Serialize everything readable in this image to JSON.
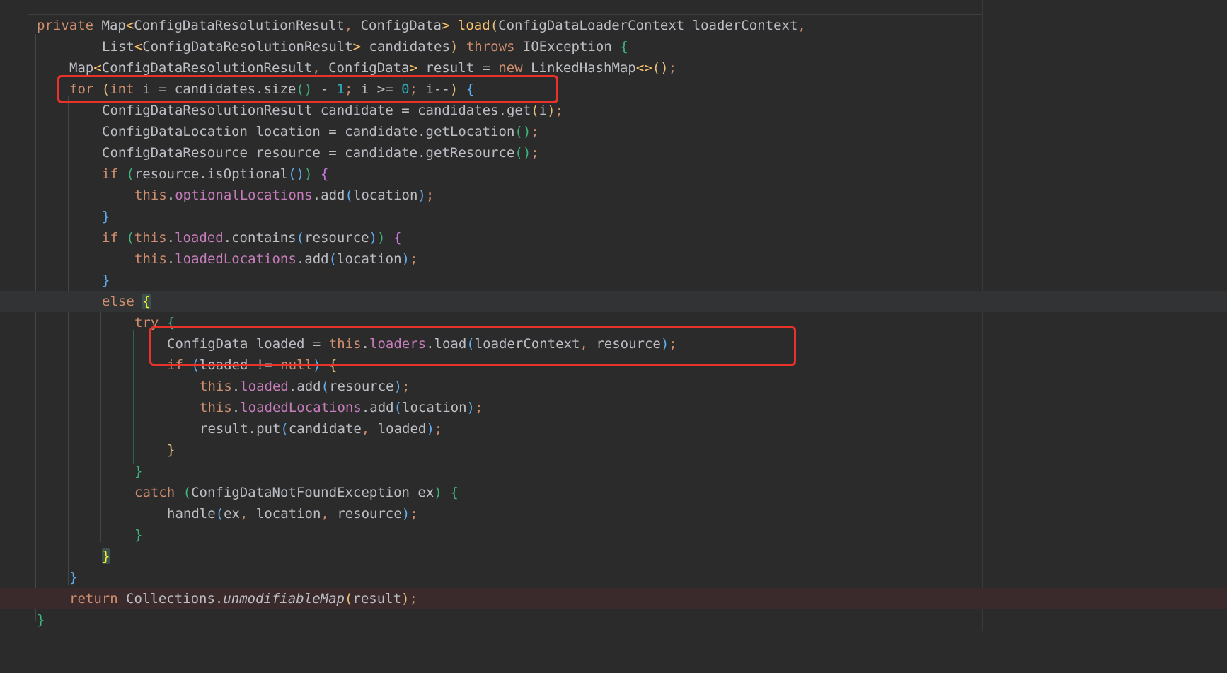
{
  "editor": {
    "language": "Java",
    "theme": "dark",
    "colors": {
      "background": "#2b2b2c",
      "keyword": "#cf8e6d",
      "text": "#bcbec4",
      "field": "#c77dbb",
      "number": "#2aacb8",
      "highlight_box": "#e8322a",
      "error_line": "#3a2a2c"
    },
    "lines": [
      "private Map<ConfigDataResolutionResult, ConfigData> load(ConfigDataLoaderContext loaderContext,",
      "        List<ConfigDataResolutionResult> candidates) throws IOException {",
      "    Map<ConfigDataResolutionResult, ConfigData> result = new LinkedHashMap<>();",
      "    for (int i = candidates.size() - 1; i >= 0; i--) {",
      "        ConfigDataResolutionResult candidate = candidates.get(i);",
      "        ConfigDataLocation location = candidate.getLocation();",
      "        ConfigDataResource resource = candidate.getResource();",
      "        if (resource.isOptional()) {",
      "            this.optionalLocations.add(location);",
      "        }",
      "        if (this.loaded.contains(resource)) {",
      "            this.loadedLocations.add(location);",
      "        }",
      "        else {",
      "            try {",
      "                ConfigData loaded = this.loaders.load(loaderContext, resource);",
      "                if (loaded != null) {",
      "                    this.loaded.add(resource);",
      "                    this.loadedLocations.add(location);",
      "                    result.put(candidate, loaded);",
      "                }",
      "            }",
      "            catch (ConfigDataNotFoundException ex) {",
      "                handle(ex, location, resource);",
      "            }",
      "        }",
      "    }",
      "    return Collections.unmodifiableMap(result);",
      "}"
    ],
    "highlighted_lines": [
      4,
      16
    ],
    "caret_line": 14,
    "error_line": 28
  }
}
